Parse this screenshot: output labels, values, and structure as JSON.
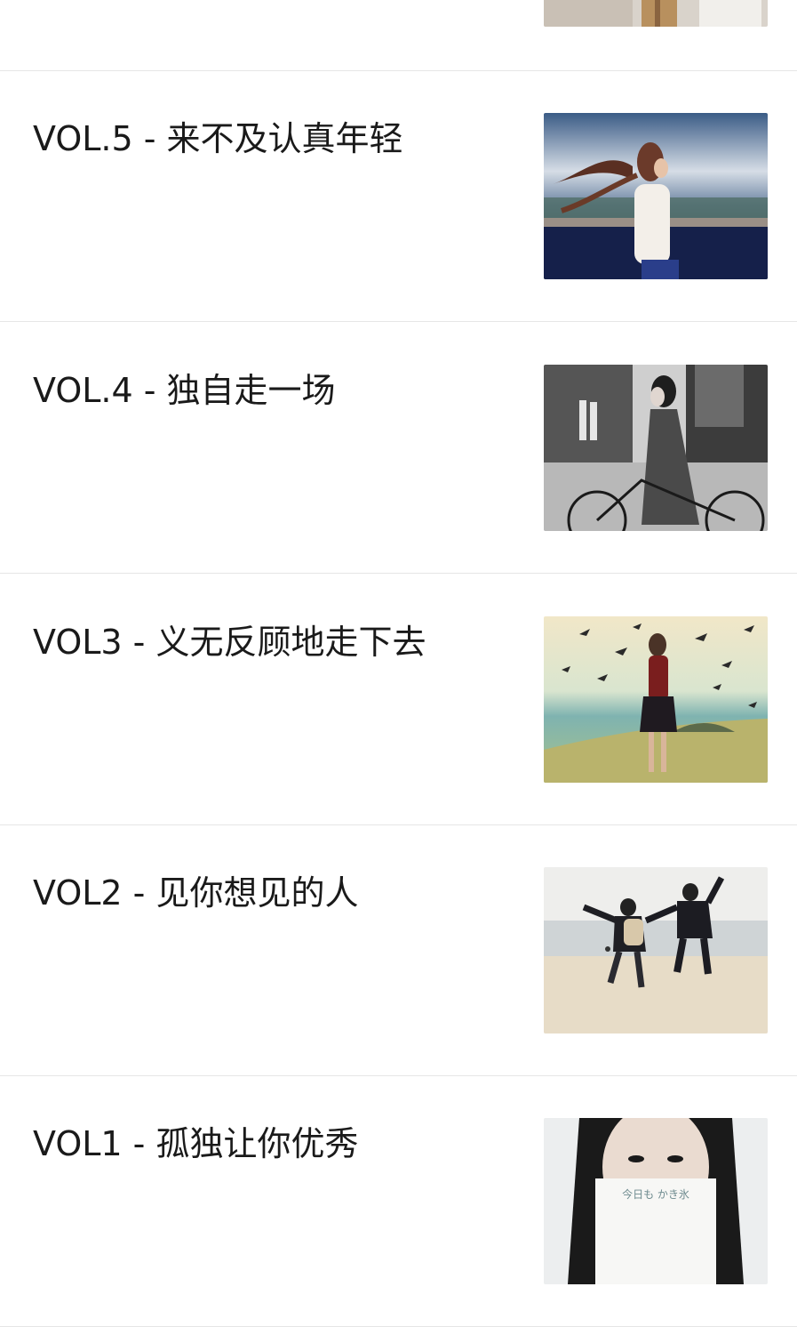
{
  "articles": [
    {
      "title": ""
    },
    {
      "title": "VOL.5 - 来不及认真年轻"
    },
    {
      "title": "VOL.4 - 独自走一场"
    },
    {
      "title": "VOL3 - 义无反顾地走下去"
    },
    {
      "title": "VOL2 - 见你想见的人"
    },
    {
      "title": "VOL1 - 孤独让你优秀"
    }
  ],
  "thumbnails": {
    "vol1_caption": "今日も かき氷"
  }
}
